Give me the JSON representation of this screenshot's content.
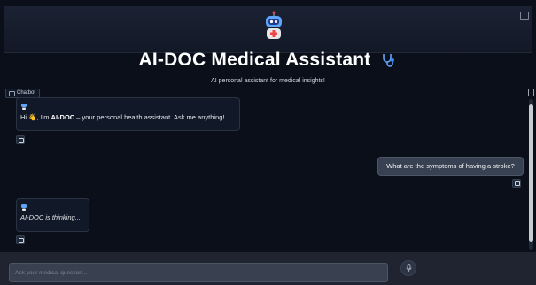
{
  "header": {
    "logo_icon": "robot-doctor-icon",
    "fullscreen_icon": "fullscreen-icon"
  },
  "title": "AI-DOC Medical Assistant",
  "title_icon": "stethoscope-icon",
  "subtitle": "AI personal assistant for medical insights!",
  "chatbot": {
    "label": "Chatbot",
    "label_icon": "chat-icon",
    "clear_icon": "trash-icon",
    "messages": [
      {
        "role": "assistant",
        "greeting": "Hi",
        "emoji": "👋",
        "pre": ", I'm ",
        "bold": "AI-DOC",
        "post": " – your personal health assistant. Ask me anything!"
      },
      {
        "role": "user",
        "text": "What are the symptoms of having a stroke?"
      },
      {
        "role": "assistant",
        "text": "AI-DOC is thinking..."
      }
    ],
    "copy_icon": "copy-icon"
  },
  "input": {
    "placeholder": "Ask your medical question...",
    "value": ""
  },
  "mic_icon": "microphone-icon",
  "colors": {
    "background": "#0b0f19",
    "bubble": "#111827",
    "user_bubble": "#374151",
    "accent": "#3b82f6"
  }
}
